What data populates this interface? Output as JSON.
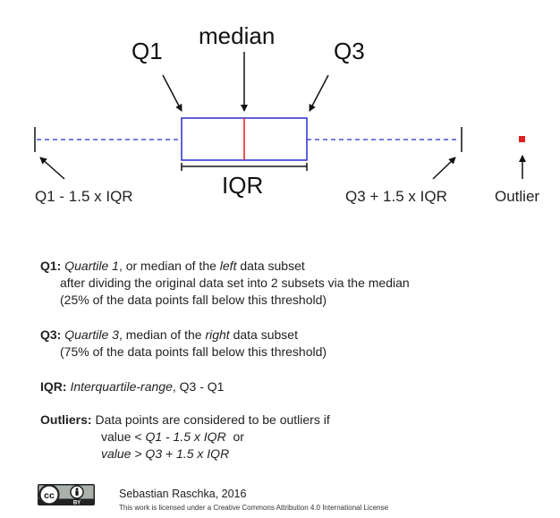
{
  "labels": {
    "q1": "Q1",
    "median": "median",
    "q3": "Q3",
    "iqr": "IQR",
    "lower_fence": "Q1 - 1.5 x IQR",
    "upper_fence": "Q3 + 1.5 x IQR",
    "outlier": "Outlier"
  },
  "colors": {
    "box": "#2b2bd6",
    "median_line": "#e02020",
    "whisker": "#2b2bd6",
    "outlier": "#e02020"
  },
  "definitions": {
    "q1": {
      "term": "Q1:",
      "italic1": "Quartile 1",
      "text1": ", or median of the ",
      "italic2": "left",
      "text2": " data subset",
      "line2": "after dividing the original data set into 2 subsets via the median",
      "line3": "(25% of the data points fall below this threshold)"
    },
    "q3": {
      "term": "Q3:",
      "italic1": "Quartile 3",
      "text1": ", median of the ",
      "italic2": "right",
      "text2": " data subset",
      "line2": "(75% of the data points fall below this threshold)"
    },
    "iqr": {
      "term": "IQR:",
      "italic1": "Interquartile-range",
      "text1": ", Q3 - Q1"
    },
    "outliers": {
      "term": "Outliers:",
      "text1": " Data points are considered to be outliers if",
      "cond1_pre": "value < ",
      "cond1_italic": "Q1 - 1.5 x IQR",
      "cond1_post": "  or",
      "cond2_italic": "value > Q3 + 1.5 x IQR"
    }
  },
  "footer": {
    "cc_badge": "cc",
    "by_badge": "BY",
    "author": "Sebastian Raschka, 2016",
    "license": "This work is licensed under a Creative Commons Attribution 4.0 International License"
  }
}
